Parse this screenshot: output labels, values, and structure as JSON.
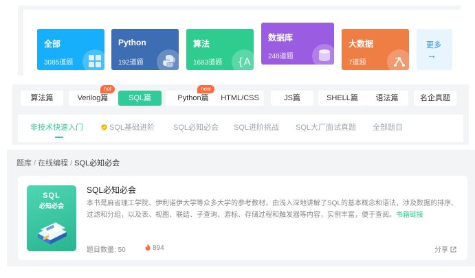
{
  "categories": [
    {
      "title": "全部",
      "count": "3085道题",
      "color": "#17aefc",
      "icon": "grid-icon"
    },
    {
      "title": "Python",
      "count": "192道题",
      "color": "#3d6eb3",
      "icon": "python-icon"
    },
    {
      "title": "算法",
      "count": "1683道题",
      "color": "#2fcc8f",
      "icon": "braces-icon"
    },
    {
      "title": "数据库",
      "count": "248道题",
      "color": "#9a5ce0",
      "icon": "database-icon"
    },
    {
      "title": "大数据",
      "count": "7道题",
      "color": "#ef7e44",
      "icon": "network-icon"
    }
  ],
  "more": {
    "label": "更多",
    "arrow": "→"
  },
  "tags": [
    {
      "label": "算法篇"
    },
    {
      "label": "Verilog篇",
      "badge": "hot"
    },
    {
      "label": "SQL篇",
      "active": true
    },
    {
      "label": "Python篇",
      "badge": "new"
    },
    {
      "label": "HTML/CSS"
    },
    {
      "label": "JS篇"
    },
    {
      "label": "SHELL篇"
    },
    {
      "label": "语法篇"
    },
    {
      "label": "名企真题"
    }
  ],
  "sub_tabs": [
    {
      "label": "非技术快速入门",
      "active": true
    },
    {
      "label": "SQL基础进阶",
      "icon": "shield-icon"
    },
    {
      "label": "SQL必知必会"
    },
    {
      "label": "SQL进阶挑战"
    },
    {
      "label": "SQL大厂面试真题"
    },
    {
      "label": "全部题目"
    }
  ],
  "breadcrumb": {
    "root": "题库",
    "section": "在线编程",
    "current": "SQL必知必会",
    "sep": "/"
  },
  "book": {
    "cover_line1": "SQL",
    "cover_line2": "必知必会",
    "title": "SQL必知必会",
    "description": "本书是麻省理工学院、伊利诺伊大学等众多大学的参考教材，由浅入深地讲解了SQL的基本概念和语法，涉及数据的排序、过滤和分组，以及表、视图、联结、子查询、游标、存储过程和触发器等内容，实例丰富，便于查阅。",
    "link_label": "书籍链接",
    "count_label": "题目数量:",
    "count_value": "50",
    "hot_value": "894",
    "share_label": "分享"
  }
}
